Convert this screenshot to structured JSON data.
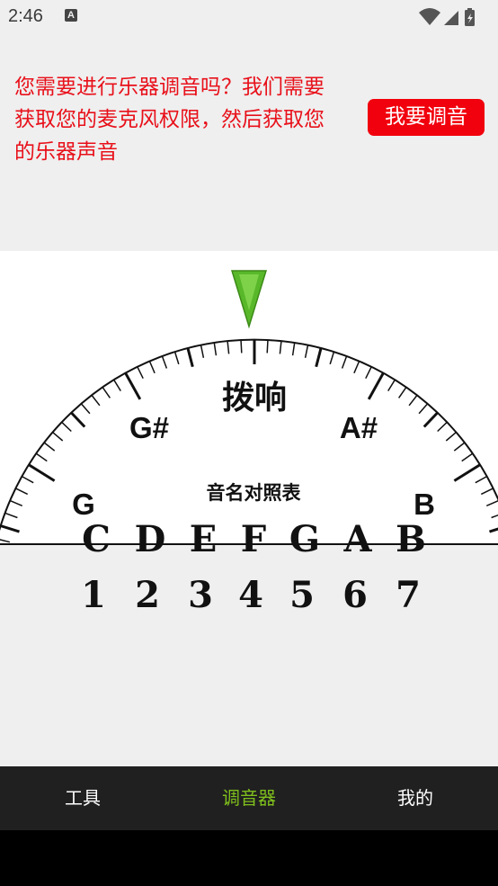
{
  "status_bar": {
    "time": "2:46",
    "notification_icon": "A",
    "icons": [
      "wifi-icon",
      "signal-icon",
      "battery-charging-icon"
    ]
  },
  "prompt": {
    "message_lines": [
      "您需要进行乐器调音吗？我们需要",
      "获取您的麦克风权限，然后获取您",
      "的乐器声音"
    ],
    "button_label": "我要调音"
  },
  "tuner": {
    "pointer_icon": "green-triangle-pointer",
    "dial_label": "拨响",
    "note_labels": {
      "left_outer": "G",
      "left_inner": "G#",
      "right_inner": "A#",
      "right_outer": "B"
    },
    "reference_title": "音名对照表",
    "note_names": [
      "C",
      "D",
      "E",
      "F",
      "G",
      "A",
      "B"
    ],
    "solfege_numbers": [
      "1",
      "2",
      "3",
      "4",
      "5",
      "6",
      "7"
    ]
  },
  "bottom_nav": {
    "items": [
      {
        "label": "工具",
        "active": false
      },
      {
        "label": "调音器",
        "active": true
      },
      {
        "label": "我的",
        "active": false
      }
    ],
    "active_color": "#7fbf1c"
  },
  "colors": {
    "prompt_text": "#e8101a",
    "button_bg": "#f1000d",
    "pointer_green": "#5fbf2a"
  }
}
